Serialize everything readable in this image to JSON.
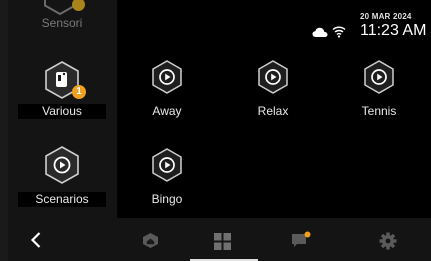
{
  "status": {
    "date": "20 MAR 2024",
    "time": "11:23 AM"
  },
  "sidebar": {
    "items": [
      {
        "label": "Sensori",
        "icon": "scenario-hex-icon",
        "dimmed": true
      },
      {
        "label": "Various",
        "icon": "device-hex-icon",
        "badge": "1"
      },
      {
        "label": "Scenarios",
        "icon": "scenario-hex-icon"
      }
    ]
  },
  "scenes": [
    {
      "label": "Away",
      "icon": "play-scene-icon"
    },
    {
      "label": "Relax",
      "icon": "play-scene-icon"
    },
    {
      "label": "Tennis",
      "icon": "play-scene-icon"
    },
    {
      "label": "Bingo",
      "icon": "play-scene-icon"
    }
  ],
  "bottom_nav": {
    "items": [
      "back-chevron-icon",
      "home-icon",
      "grid-icon",
      "chat-icon",
      "gear-icon"
    ],
    "active": "grid-icon",
    "notification_color": "#f0a020"
  },
  "colors": {
    "background": "#000000",
    "panel": "#141414",
    "accent": "#f0a020",
    "text": "#e8e8e8"
  }
}
